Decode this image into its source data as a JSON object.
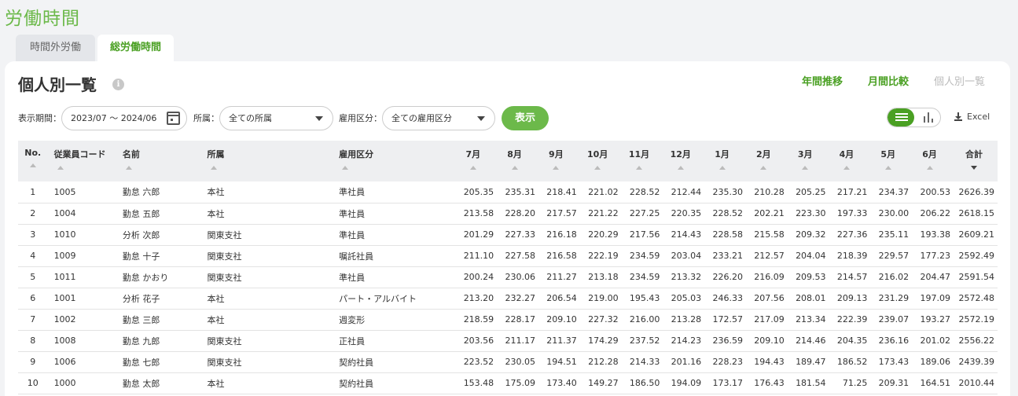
{
  "page": {
    "title": "労働時間"
  },
  "tabs": [
    {
      "label": "時間外労働",
      "active": false
    },
    {
      "label": "総労働時間",
      "active": true
    }
  ],
  "section": {
    "title": "個人別一覧",
    "info_icon": "i"
  },
  "view_links": [
    "年間推移",
    "月間比較",
    "個人別一覧"
  ],
  "filters": {
    "period_label": "表示期間：",
    "period_value": "2023/07 〜 2024/06",
    "dept_label": "所属：",
    "dept_value": "全ての所属",
    "emp_label": "雇用区分：",
    "emp_value": "全ての雇用区分",
    "show_button": "表示"
  },
  "toolbar": {
    "excel_label": "Excel"
  },
  "colors": {
    "accent": "#6cb94a",
    "accent_dark": "#4aa023"
  },
  "table": {
    "headers": {
      "no": "No.",
      "code": "従業員コード",
      "name": "名前",
      "dept": "所属",
      "emp": "雇用区分",
      "m1": "7月",
      "m2": "8月",
      "m3": "9月",
      "m4": "10月",
      "m5": "11月",
      "m6": "12月",
      "m7": "1月",
      "m8": "2月",
      "m9": "3月",
      "m10": "4月",
      "m11": "5月",
      "m12": "6月",
      "total": "合計"
    },
    "rows": [
      [
        "1",
        "1005",
        "勤怠 六郎",
        "本社",
        "準社員",
        "205.35",
        "235.31",
        "218.41",
        "221.02",
        "228.52",
        "212.44",
        "235.30",
        "210.28",
        "205.25",
        "217.21",
        "234.37",
        "200.53",
        "2626.39"
      ],
      [
        "2",
        "1004",
        "勤怠 五郎",
        "本社",
        "準社員",
        "213.58",
        "228.20",
        "217.57",
        "221.22",
        "227.25",
        "220.35",
        "228.52",
        "202.21",
        "223.30",
        "197.33",
        "230.00",
        "206.22",
        "2618.15"
      ],
      [
        "3",
        "1010",
        "分析 次郎",
        "関東支社",
        "準社員",
        "201.29",
        "227.33",
        "216.18",
        "220.29",
        "217.56",
        "214.43",
        "228.58",
        "215.58",
        "209.32",
        "227.36",
        "235.11",
        "193.38",
        "2609.21"
      ],
      [
        "4",
        "1009",
        "勤怠 十子",
        "関東支社",
        "嘱託社員",
        "211.10",
        "227.58",
        "216.58",
        "222.19",
        "234.59",
        "203.04",
        "233.21",
        "212.57",
        "204.04",
        "218.39",
        "229.57",
        "177.23",
        "2592.49"
      ],
      [
        "5",
        "1011",
        "勤怠 かおり",
        "関東支社",
        "準社員",
        "200.24",
        "230.06",
        "211.27",
        "213.18",
        "234.59",
        "213.32",
        "226.20",
        "216.09",
        "209.53",
        "214.57",
        "216.02",
        "204.47",
        "2591.54"
      ],
      [
        "6",
        "1001",
        "分析 花子",
        "本社",
        "パート・アルバイト",
        "213.20",
        "232.27",
        "206.54",
        "219.00",
        "195.43",
        "205.03",
        "246.33",
        "207.56",
        "208.01",
        "209.13",
        "231.29",
        "197.09",
        "2572.48"
      ],
      [
        "7",
        "1002",
        "勤怠 三郎",
        "本社",
        "週変形",
        "218.59",
        "228.17",
        "209.10",
        "227.32",
        "216.00",
        "213.28",
        "172.57",
        "217.09",
        "213.34",
        "222.39",
        "239.07",
        "193.27",
        "2572.19"
      ],
      [
        "8",
        "1008",
        "勤怠 九郎",
        "関東支社",
        "正社員",
        "203.56",
        "211.17",
        "211.37",
        "174.29",
        "237.52",
        "214.23",
        "236.59",
        "209.10",
        "214.46",
        "204.35",
        "236.16",
        "201.02",
        "2556.22"
      ],
      [
        "9",
        "1006",
        "勤怠 七郎",
        "関東支社",
        "契約社員",
        "223.52",
        "230.05",
        "194.51",
        "212.28",
        "214.33",
        "201.16",
        "228.23",
        "194.43",
        "189.47",
        "186.52",
        "173.43",
        "189.06",
        "2439.39"
      ],
      [
        "10",
        "1000",
        "勤怠 太郎",
        "本社",
        "契約社員",
        "153.48",
        "175.09",
        "173.40",
        "149.27",
        "186.50",
        "194.09",
        "173.17",
        "176.43",
        "181.54",
        "71.25",
        "209.31",
        "164.51",
        "2010.44"
      ]
    ]
  }
}
